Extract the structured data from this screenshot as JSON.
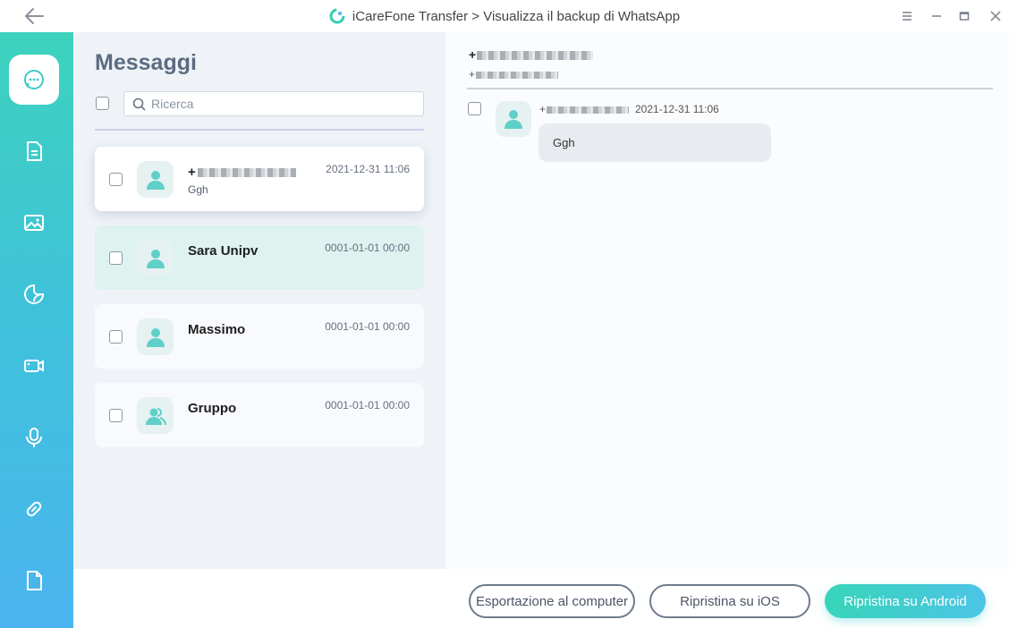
{
  "window": {
    "title": "iCareFone Transfer > Visualizza il backup di WhatsApp",
    "controls": [
      "menu-icon",
      "minimize-icon",
      "maximize-icon",
      "close-icon"
    ]
  },
  "sidebar": {
    "items": [
      {
        "icon": "message-icon",
        "active": true
      },
      {
        "icon": "document-icon",
        "active": false
      },
      {
        "icon": "image-icon",
        "active": false
      },
      {
        "icon": "sticker-icon",
        "active": false
      },
      {
        "icon": "video-icon",
        "active": false
      },
      {
        "icon": "microphone-icon",
        "active": false
      },
      {
        "icon": "link-icon",
        "active": false
      },
      {
        "icon": "file-icon",
        "active": false
      }
    ]
  },
  "list": {
    "title": "Messaggi",
    "search_placeholder": "Ricerca",
    "chats": [
      {
        "name": "+",
        "time": "2021-12-31 11:06",
        "preview": "Ggh",
        "redacted": true,
        "state": "selected",
        "type": "contact"
      },
      {
        "name": "Sara Unipv",
        "time": "0001-01-01 00:00",
        "preview": "",
        "redacted": false,
        "state": "hover",
        "type": "contact"
      },
      {
        "name": "Massimo",
        "time": "0001-01-01 00:00",
        "preview": "",
        "redacted": false,
        "state": "normal",
        "type": "contact"
      },
      {
        "name": "Gruppo",
        "time": "0001-01-01 00:00",
        "preview": "",
        "redacted": false,
        "state": "normal",
        "type": "group"
      }
    ]
  },
  "conversation": {
    "header_name": "+",
    "header_sub": "+",
    "message": {
      "sender": "+",
      "time": "2021-12-31 11:06",
      "text": "Ggh"
    }
  },
  "actions": {
    "export": "Esportazione al computer",
    "restore_ios": "Ripristina su iOS",
    "restore_android": "Ripristina su Android"
  },
  "colors": {
    "accent": "#3fd0bf",
    "sidebar_top": "#3dd3bd",
    "sidebar_bottom": "#4bb5ef",
    "list_bg": "#eff3f8"
  }
}
